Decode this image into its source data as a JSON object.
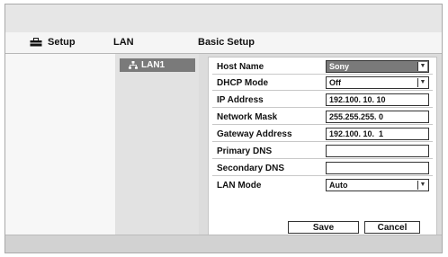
{
  "header": {
    "setup_label": "Setup",
    "lan_label": "LAN",
    "section_title": "Basic Setup"
  },
  "sidebar": {
    "selected_item": "LAN1"
  },
  "form": {
    "host_name": {
      "label": "Host Name",
      "value": "Sony"
    },
    "dhcp_mode": {
      "label": "DHCP Mode",
      "value": "Off"
    },
    "ip_address": {
      "label": "IP Address",
      "value": "192.100. 10. 10"
    },
    "network_mask": {
      "label": "Network Mask",
      "value": "255.255.255. 0"
    },
    "gateway_address": {
      "label": "Gateway Address",
      "value": "192.100. 10.  1"
    },
    "primary_dns": {
      "label": "Primary DNS",
      "value": ""
    },
    "secondary_dns": {
      "label": "Secondary DNS",
      "value": ""
    },
    "lan_mode": {
      "label": "LAN Mode",
      "value": "Auto"
    }
  },
  "buttons": {
    "save": "Save",
    "cancel": "Cancel"
  },
  "icons": {
    "setup": "toolbox-icon",
    "lan1": "network-icon",
    "dropdown": "triangle-down-icon"
  }
}
